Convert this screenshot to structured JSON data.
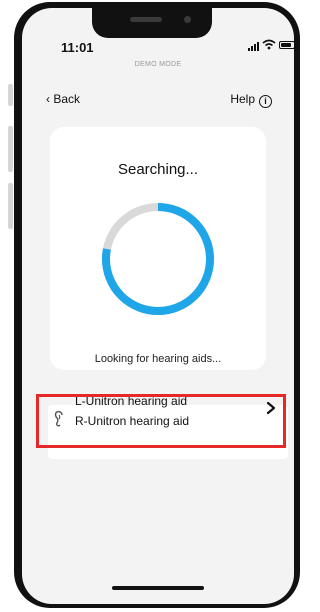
{
  "status_bar": {
    "time": "11:01",
    "mode_label": "DEMO MODE",
    "wifi_icon": "wifi-icon",
    "battery_icon": "battery-icon"
  },
  "nav": {
    "back_label": "Back",
    "help_label": "Help",
    "help_icon": "info-icon"
  },
  "search_card": {
    "title": "Searching...",
    "subtitle": "Looking for hearing aids...",
    "progress": 0.78,
    "progress_color": "#1ea6e8",
    "track_color": "#d9d9d9"
  },
  "devices": {
    "items": [
      {
        "label": "L-Unitron hearing aid"
      },
      {
        "label": "R-Unitron hearing aid"
      }
    ],
    "highlight_color": "#e62828"
  }
}
